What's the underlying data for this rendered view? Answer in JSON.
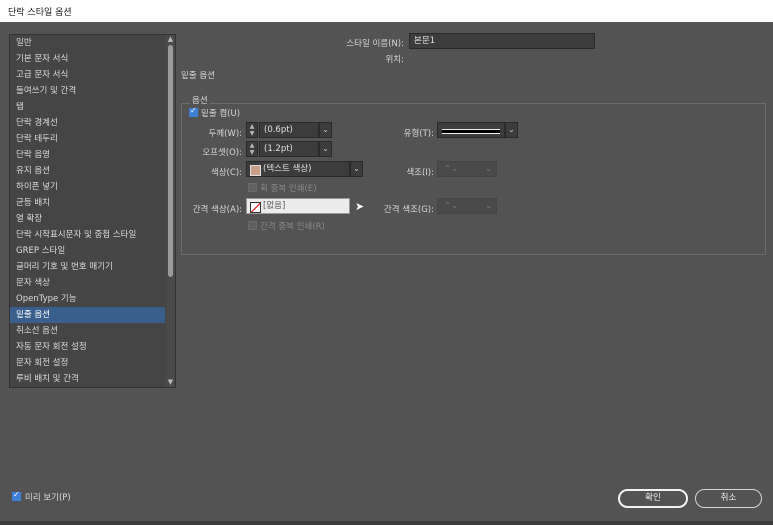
{
  "window": {
    "title": "단락 스타일 옵션"
  },
  "sidebar": {
    "items": [
      {
        "label": "일반"
      },
      {
        "label": "기본 문자 서식"
      },
      {
        "label": "고급 문자 서식"
      },
      {
        "label": "들여쓰기 및 간격"
      },
      {
        "label": "탭"
      },
      {
        "label": "단락 경계선"
      },
      {
        "label": "단락 테두리"
      },
      {
        "label": "단락 음영"
      },
      {
        "label": "유지 옵션"
      },
      {
        "label": "하이픈 넣기"
      },
      {
        "label": "균등 배치"
      },
      {
        "label": "열 확장"
      },
      {
        "label": "단락 시작표시문자 및 중첩 스타일"
      },
      {
        "label": "GREP 스타일"
      },
      {
        "label": "글머리 기호 및 번호 매기기"
      },
      {
        "label": "문자 색상"
      },
      {
        "label": "OpenType 기능"
      },
      {
        "label": "밑줄 옵션"
      },
      {
        "label": "취소선 옵션"
      },
      {
        "label": "자동 문자 회전 설정"
      },
      {
        "label": "문자 회전 설정"
      },
      {
        "label": "루비 배치 및 간격"
      }
    ],
    "selected_index": 17
  },
  "header": {
    "style_name_label": "스타일 이름(N):",
    "style_name_value": "본문1",
    "location_label": "위치:",
    "section_title": "밑줄 옵션"
  },
  "options": {
    "group_label": "옵션",
    "underline_on_label": "밑줄 켬(U)",
    "underline_on": true,
    "weight_label": "두께(W):",
    "weight_value": "(0.6pt)",
    "type_label": "유형(T):",
    "offset_label": "오프셋(O):",
    "offset_value": "(1.2pt)",
    "color_label": "색상(C):",
    "color_value": "(텍스트 색상)",
    "color_swatch": "#c8a088",
    "tint_label": "색조(I):",
    "overprint_stroke_label": "획 중복 인쇄(E)",
    "gap_color_label": "간격 색상(A):",
    "gap_color_value": "[없음]",
    "gap_tint_label": "간격 색조(G):",
    "overprint_gap_label": "간격 중복 인쇄(R)"
  },
  "footer": {
    "preview_label": "미리 보기(P)",
    "preview_checked": true,
    "ok_label": "확인",
    "cancel_label": "취소"
  },
  "colors": {
    "selection": "#3a5f8d",
    "background": "#535353"
  }
}
